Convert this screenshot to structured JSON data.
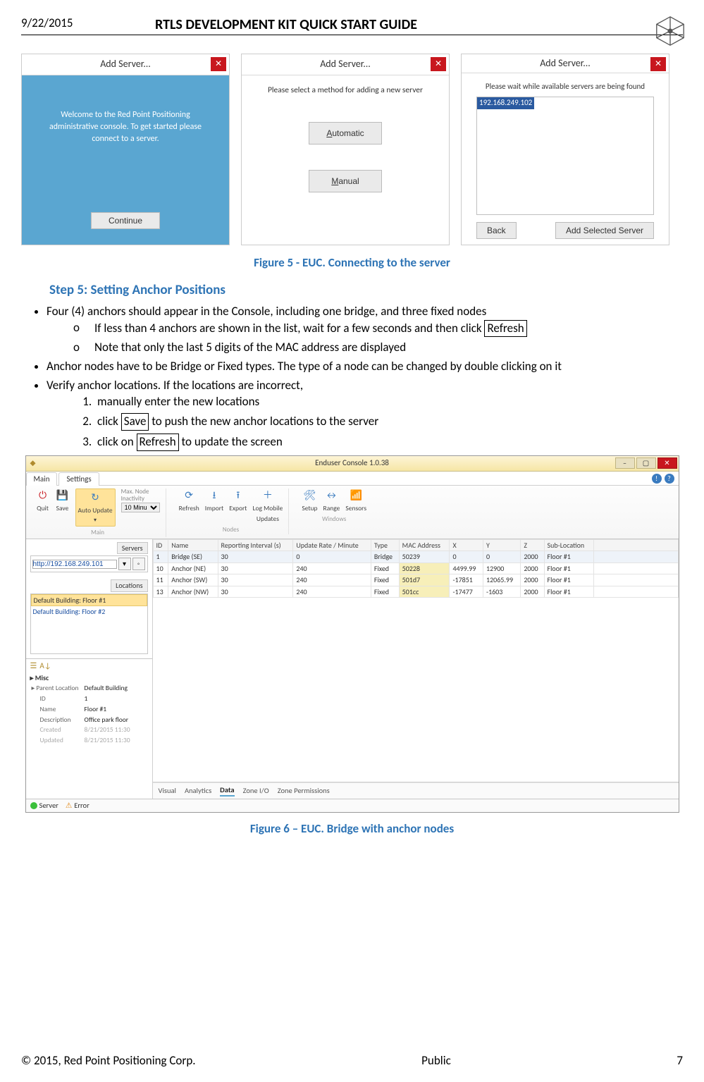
{
  "header": {
    "date": "9/22/2015",
    "title": "RTLS DEVELOPMENT KIT QUICK START GUIDE"
  },
  "dialogs": {
    "title": "Add Server...",
    "close_glyph": "✕",
    "d1": {
      "welcome": "Welcome to the Red Point Positioning administrative console. To get started please connect to a server.",
      "continue": "Continue"
    },
    "d2": {
      "msg": "Please select a method for adding a new server",
      "auto": "Automatic",
      "manual": "Manual"
    },
    "d3": {
      "msg": "Please wait while available servers are being found",
      "ip": "192.168.249.102",
      "back": "Back",
      "add": "Add Selected Server"
    }
  },
  "fig5": "Figure 5 - EUC. Connecting to the server",
  "step5": "Step 5: Setting Anchor Positions",
  "b1": "Four (4) anchors should appear in the Console, including one bridge, and three fixed nodes",
  "b1a_pre": "If less than 4 anchors are shown in the list, wait for a few seconds and then click ",
  "b1a_box": "Refresh",
  "b1b": "Note that only the last 5 digits of the MAC address are displayed",
  "b2": "Anchor nodes have to be Bridge or Fixed types. The type of a node can be changed by double clicking on it",
  "b3": "Verify anchor locations. If the locations are incorrect,",
  "b3_1": "manually enter the new locations",
  "b3_2_pre": "click ",
  "b3_2_box": "Save",
  "b3_2_post": " to push the new anchor locations to the server",
  "b3_3_pre": "click on ",
  "b3_3_box": "Refresh",
  "b3_3_post": " to update the screen",
  "console": {
    "title": "Enduser Console  1.0.38",
    "tabs": {
      "main": "Main",
      "settings": "Settings"
    },
    "ribbon": {
      "quit": "Quit",
      "save": "Save",
      "auto_update": "Auto Update",
      "maxnode_l1": "Max. Node",
      "maxnode_l2": "Inactivity",
      "maxnode_val": "10 Minu",
      "refresh": "Refresh",
      "import": "Import",
      "export": "Export",
      "logmob_l1": "Log Mobile",
      "logmob_l2": "Updates",
      "setup": "Setup",
      "range": "Range",
      "sensors": "Sensors",
      "grp_main": "Main",
      "grp_nodes": "Nodes",
      "grp_windows": "Windows"
    },
    "side": {
      "servers_title": "Servers",
      "server_url": "http://192.168.249.101",
      "locations_title": "Locations",
      "loc1": "Default Building: Floor #1",
      "loc2": "Default Building: Floor #2",
      "misc": "Misc",
      "prop": {
        "parent_l": "Parent Location",
        "parent_v": "Default Building",
        "id_l": "ID",
        "id_v": "1",
        "name_l": "Name",
        "name_v": "Floor #1",
        "desc_l": "Description",
        "desc_v": "Office park floor",
        "created_l": "Created",
        "created_v": "8/21/2015 11:30",
        "updated_l": "Updated",
        "updated_v": "8/21/2015 11:30"
      }
    },
    "table": {
      "cols": {
        "id": "ID",
        "name": "Name",
        "rep": "Reporting Interval (s)",
        "rate": "Update Rate / Minute",
        "type": "Type",
        "mac": "MAC Address",
        "x": "X",
        "y": "Y",
        "z": "Z",
        "sub": "Sub-Location"
      },
      "rows": [
        {
          "id": "1",
          "name": "Bridge (SE)",
          "rep": "30",
          "rate": "0",
          "type": "Bridge",
          "mac": "50239",
          "x": "0",
          "y": "0",
          "z": "2000",
          "sub": "Floor #1"
        },
        {
          "id": "10",
          "name": "Anchor (NE)",
          "rep": "30",
          "rate": "240",
          "type": "Fixed",
          "mac": "50228",
          "x": "4499.99",
          "y": "12900",
          "z": "2000",
          "sub": "Floor #1"
        },
        {
          "id": "11",
          "name": "Anchor (SW)",
          "rep": "30",
          "rate": "240",
          "type": "Fixed",
          "mac": "501d7",
          "x": "-17851",
          "y": "12065.99",
          "z": "2000",
          "sub": "Floor #1"
        },
        {
          "id": "13",
          "name": "Anchor (NW)",
          "rep": "30",
          "rate": "240",
          "type": "Fixed",
          "mac": "501cc",
          "x": "-17477",
          "y": "-1603",
          "z": "2000",
          "sub": "Floor #1"
        }
      ]
    },
    "subtabs": {
      "visual": "Visual",
      "analytics": "Analytics",
      "data": "Data",
      "zoneio": "Zone I/O",
      "zoneperm": "Zone Permissions"
    },
    "status": {
      "server": "Server",
      "error": "Error"
    }
  },
  "fig6": "Figure 6 – EUC. Bridge with anchor nodes",
  "footer": {
    "left": "© 2015, Red Point Positioning Corp.",
    "center": "Public",
    "right": "7"
  }
}
